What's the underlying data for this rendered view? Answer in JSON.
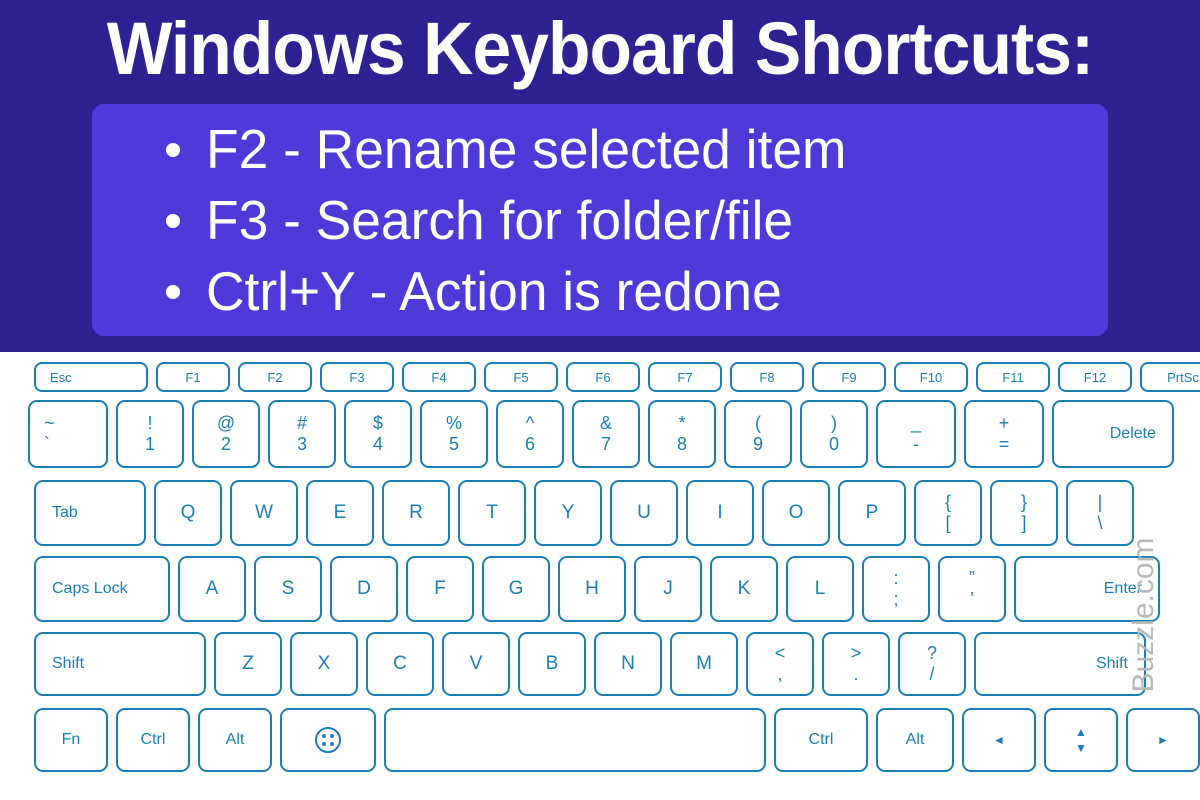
{
  "header": {
    "title": "Windows Keyboard Shortcuts:",
    "background_color": "#2e2191",
    "box_color": "#4d3ad9",
    "text_color": "#ffffff",
    "shortcuts": [
      {
        "text": "F2 - Rename selected item"
      },
      {
        "text": "F3 - Search for folder/file"
      },
      {
        "text": "Ctrl+Y - Action is redone"
      }
    ]
  },
  "watermark": {
    "text": "Buzzle.com",
    "color": "#b9b9b9"
  },
  "keyboard": {
    "key_border_color": "#1a7fb5",
    "key_face_color": "#ffffff",
    "key_text_color": "#1a7fb5",
    "rows": [
      {
        "name": "function-row",
        "keys": [
          {
            "label": "Esc",
            "type": "fn-left"
          },
          {
            "label": "F1",
            "type": "fn"
          },
          {
            "label": "F2",
            "type": "fn"
          },
          {
            "label": "F3",
            "type": "fn"
          },
          {
            "label": "F4",
            "type": "fn"
          },
          {
            "label": "F5",
            "type": "fn"
          },
          {
            "label": "F6",
            "type": "fn"
          },
          {
            "label": "F7",
            "type": "fn"
          },
          {
            "label": "F8",
            "type": "fn"
          },
          {
            "label": "F9",
            "type": "fn"
          },
          {
            "label": "F10",
            "type": "fn"
          },
          {
            "label": "F11",
            "type": "fn"
          },
          {
            "label": "F12",
            "type": "fn"
          },
          {
            "label": "PrtSc",
            "type": "fn"
          }
        ]
      },
      {
        "name": "number-row",
        "keys": [
          {
            "upper": "~",
            "lower": "`",
            "type": "dual-left"
          },
          {
            "upper": "!",
            "lower": "1",
            "type": "dual"
          },
          {
            "upper": "@",
            "lower": "2",
            "type": "dual"
          },
          {
            "upper": "#",
            "lower": "3",
            "type": "dual"
          },
          {
            "upper": "$",
            "lower": "4",
            "type": "dual"
          },
          {
            "upper": "%",
            "lower": "5",
            "type": "dual"
          },
          {
            "upper": "^",
            "lower": "6",
            "type": "dual"
          },
          {
            "upper": "&",
            "lower": "7",
            "type": "dual"
          },
          {
            "upper": "*",
            "lower": "8",
            "type": "dual"
          },
          {
            "upper": "(",
            "lower": "9",
            "type": "dual"
          },
          {
            "upper": ")",
            "lower": "0",
            "type": "dual"
          },
          {
            "upper": "_",
            "lower": "-",
            "type": "dual"
          },
          {
            "upper": "+",
            "lower": "=",
            "type": "dual"
          },
          {
            "label": "Delete",
            "type": "word-right"
          }
        ]
      },
      {
        "name": "qwerty-row",
        "keys": [
          {
            "label": "Tab",
            "type": "word-left"
          },
          {
            "label": "Q",
            "type": "std"
          },
          {
            "label": "W",
            "type": "std"
          },
          {
            "label": "E",
            "type": "std"
          },
          {
            "label": "R",
            "type": "std"
          },
          {
            "label": "T",
            "type": "std"
          },
          {
            "label": "Y",
            "type": "std"
          },
          {
            "label": "U",
            "type": "std"
          },
          {
            "label": "I",
            "type": "std"
          },
          {
            "label": "O",
            "type": "std"
          },
          {
            "label": "P",
            "type": "std"
          },
          {
            "upper": "{",
            "lower": "[",
            "type": "dual"
          },
          {
            "upper": "}",
            "lower": "]",
            "type": "dual"
          },
          {
            "upper": "|",
            "lower": "\\",
            "type": "dual"
          }
        ]
      },
      {
        "name": "home-row",
        "keys": [
          {
            "label": "Caps Lock",
            "type": "word-left"
          },
          {
            "label": "A",
            "type": "std"
          },
          {
            "label": "S",
            "type": "std"
          },
          {
            "label": "D",
            "type": "std"
          },
          {
            "label": "F",
            "type": "std"
          },
          {
            "label": "G",
            "type": "std"
          },
          {
            "label": "H",
            "type": "std"
          },
          {
            "label": "J",
            "type": "std"
          },
          {
            "label": "K",
            "type": "std"
          },
          {
            "label": "L",
            "type": "std"
          },
          {
            "upper": ":",
            "lower": ";",
            "type": "dual"
          },
          {
            "upper": "”",
            "lower": "’",
            "type": "dual"
          },
          {
            "label": "Enter",
            "type": "word-right"
          }
        ]
      },
      {
        "name": "shift-row",
        "keys": [
          {
            "label": "Shift",
            "type": "word-left"
          },
          {
            "label": "Z",
            "type": "std"
          },
          {
            "label": "X",
            "type": "std"
          },
          {
            "label": "C",
            "type": "std"
          },
          {
            "label": "V",
            "type": "std"
          },
          {
            "label": "B",
            "type": "std"
          },
          {
            "label": "N",
            "type": "std"
          },
          {
            "label": "M",
            "type": "std"
          },
          {
            "upper": "<",
            "lower": ",",
            "type": "dual"
          },
          {
            "upper": ">",
            "lower": ".",
            "type": "dual"
          },
          {
            "upper": "?",
            "lower": "/",
            "type": "dual"
          },
          {
            "label": "Shift",
            "type": "word-right"
          }
        ]
      },
      {
        "name": "bottom-row",
        "keys": [
          {
            "label": "Fn",
            "type": "std-small"
          },
          {
            "label": "Ctrl",
            "type": "std-small"
          },
          {
            "label": "Alt",
            "type": "std-small"
          },
          {
            "icon": "windows-dots-icon",
            "type": "icon"
          },
          {
            "label": "",
            "type": "spacebar"
          },
          {
            "label": "Ctrl",
            "type": "std-small"
          },
          {
            "label": "Alt",
            "type": "std-small"
          },
          {
            "icon": "arrow-left-icon",
            "glyph": "◄",
            "type": "arrow"
          },
          {
            "icon": "arrow-up-down-icon",
            "glyph_up": "▲",
            "glyph_down": "▼",
            "type": "arrows"
          },
          {
            "icon": "arrow-right-icon",
            "glyph": "►",
            "type": "arrow"
          }
        ]
      }
    ]
  }
}
